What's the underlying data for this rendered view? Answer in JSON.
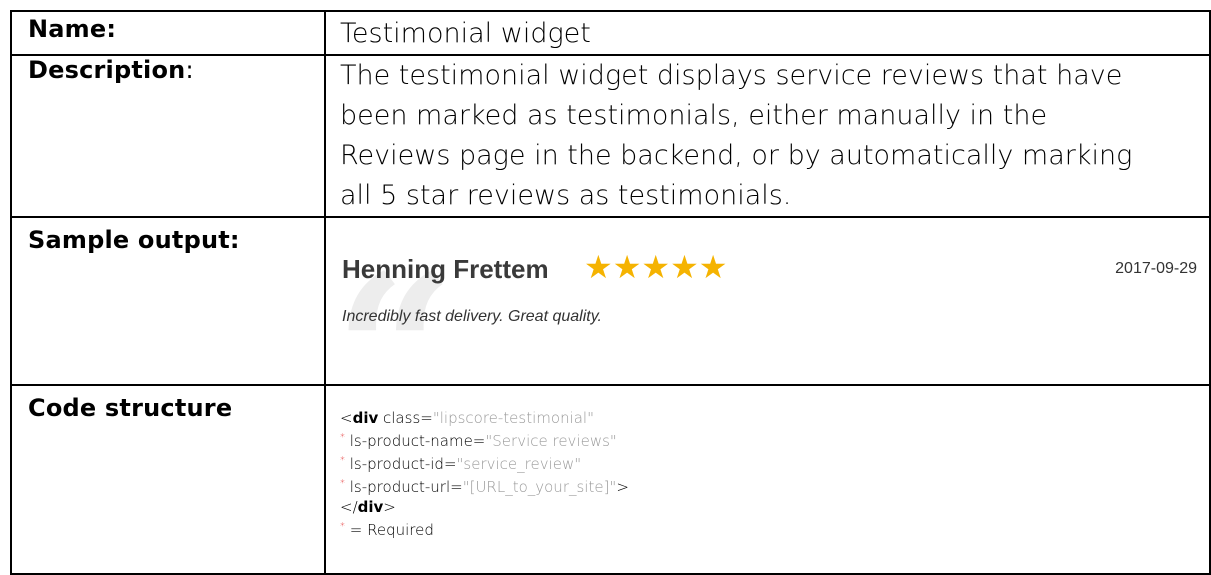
{
  "rows": {
    "name": {
      "label": "Name:",
      "value": "Testimonial widget"
    },
    "description": {
      "label": "Description",
      "label_colon": ":",
      "lines": [
        "The testimonial widget displays service reviews that have",
        "been marked as testimonials, either manually in the",
        "Reviews page in the backend, or by automatically marking",
        "all 5 star reviews as testimonials."
      ]
    },
    "sample": {
      "label": "Sample output:",
      "quote_mark": "“",
      "reviewer": "Henning Frettem",
      "rating": 5,
      "stars": "★★★★★",
      "date": "2017-09-29",
      "text": "Incredibly fast delivery. Great quality."
    },
    "code": {
      "label": "Code structure",
      "open_lt": "<",
      "tag": "div",
      "class_attr": " class=",
      "class_val": "\"lipscore-testimonial\"",
      "req": "*",
      "attr1": " ls-product-name=",
      "val1": "\"Service reviews\"",
      "attr2": " ls-product-id=",
      "val2": "\"service_review\"",
      "attr3": " ls-product-url=",
      "val3": "\"[URL_to_your_site]\"",
      "gt": ">",
      "close_lt": "</",
      "close_tag": "div",
      "close_gt": ">",
      "req_note": " = Required"
    }
  },
  "colors": {
    "star": "#f5b301",
    "required": "#e02020",
    "attr_value": "#999999"
  }
}
